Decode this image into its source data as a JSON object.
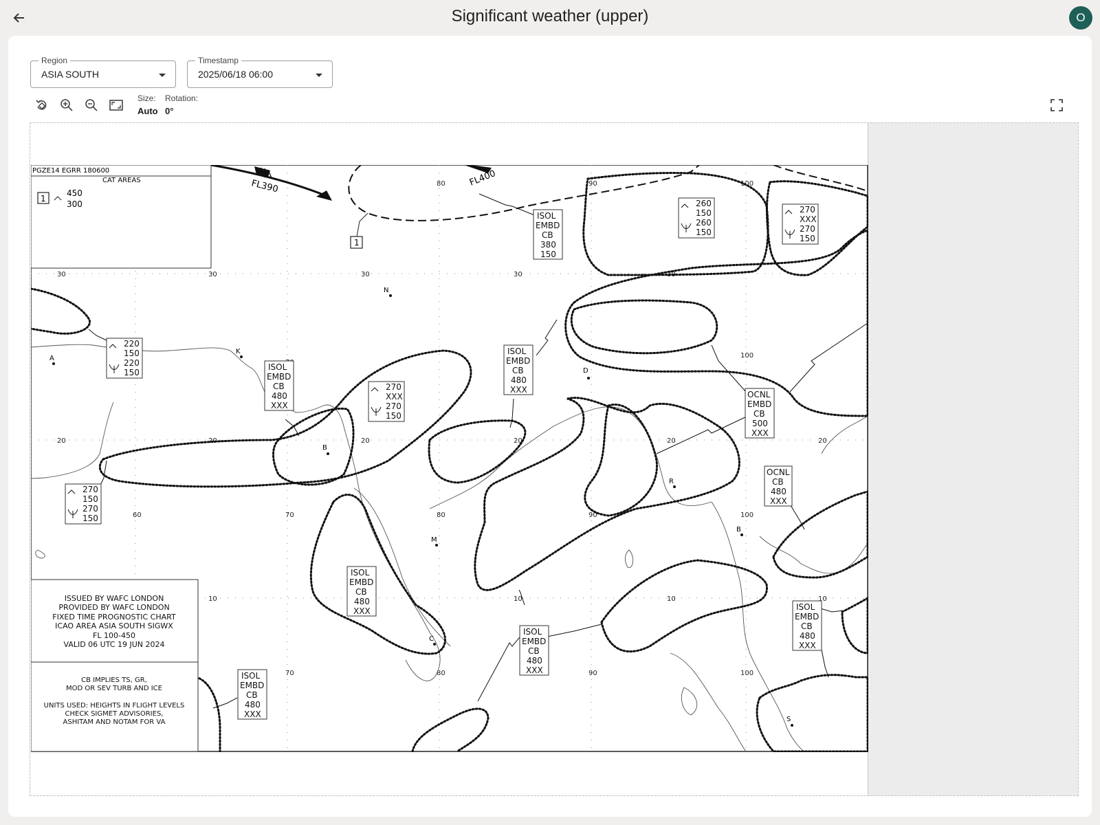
{
  "header": {
    "title": "Significant weather (upper)",
    "avatar_initial": "O",
    "back_icon": "arrow-left-icon"
  },
  "filters": {
    "region": {
      "label": "Region",
      "value": "ASIA SOUTH"
    },
    "timestamp": {
      "label": "Timestamp",
      "value": "2025/06/18 06:00"
    }
  },
  "toolbar": {
    "icons": [
      "rotate-icon",
      "zoom-in-icon",
      "zoom-out-icon",
      "fit-screen-icon",
      "fullscreen-icon"
    ],
    "size_label": "Size:",
    "size_value": "Auto",
    "rotation_label": "Rotation:",
    "rotation_value": "0°"
  },
  "chart": {
    "header_code": "PGZE14 EGRR 180600",
    "cat_title": "CAT AREAS",
    "cat_number": "1",
    "cat_top": "450",
    "cat_base": "300",
    "jet_labels": [
      "FL390",
      "FL400"
    ],
    "cat_marker": "1",
    "lat_labels": [
      "30",
      "20",
      "10"
    ],
    "lon_labels": [
      "60",
      "70",
      "80",
      "90",
      "100"
    ],
    "stations": [
      "N",
      "K",
      "A",
      "D",
      "B",
      "M",
      "R",
      "B",
      "C",
      "S"
    ],
    "boxes": [
      {
        "lines": [
          "220",
          "150",
          "220",
          "150"
        ]
      },
      {
        "lines": [
          "ISOL",
          "EMBD",
          "CB",
          "480",
          "XXX"
        ]
      },
      {
        "lines": [
          "270",
          "XXX",
          "270",
          "150"
        ]
      },
      {
        "lines": [
          "ISOL",
          "EMBD",
          "CB",
          "380",
          "150"
        ]
      },
      {
        "lines": [
          "260",
          "150",
          "260",
          "150"
        ]
      },
      {
        "lines": [
          "270",
          "XXX",
          "270",
          "150"
        ]
      },
      {
        "lines": [
          "ISOL",
          "EMBD",
          "CB",
          "480",
          "XXX"
        ]
      },
      {
        "lines": [
          "OCNL",
          "EMBD",
          "CB",
          "500",
          "XXX"
        ]
      },
      {
        "lines": [
          "270",
          "150",
          "270",
          "150"
        ]
      },
      {
        "lines": [
          "OCNL",
          "CB",
          "480",
          "XXX"
        ]
      },
      {
        "lines": [
          "ISOL",
          "EMBD",
          "CB",
          "480",
          "XXX"
        ]
      },
      {
        "lines": [
          "ISOL",
          "EMBD",
          "CB",
          "480",
          "XXX"
        ]
      },
      {
        "lines": [
          "ISOL",
          "EMBD",
          "CB",
          "480",
          "XXX"
        ]
      },
      {
        "lines": [
          "ISOL",
          "EMBD",
          "CB",
          "480",
          "XXX"
        ]
      }
    ],
    "issued_lines": [
      "ISSUED BY WAFC LONDON",
      "PROVIDED BY WAFC LONDON",
      "FIXED TIME PROGNOSTIC CHART",
      "ICAO AREA ASIA SOUTH SIGWX",
      "FL 100-450",
      "VALID 06 UTC 19 JUN 2024"
    ],
    "notes_lines": [
      "CB IMPLIES TS, GR,",
      "MOD OR SEV TURB AND ICE",
      "",
      "UNITS USED: HEIGHTS IN FLIGHT LEVELS",
      "CHECK SIGMET ADVISORIES,",
      "ASHITAM AND NOTAM FOR VA"
    ]
  }
}
